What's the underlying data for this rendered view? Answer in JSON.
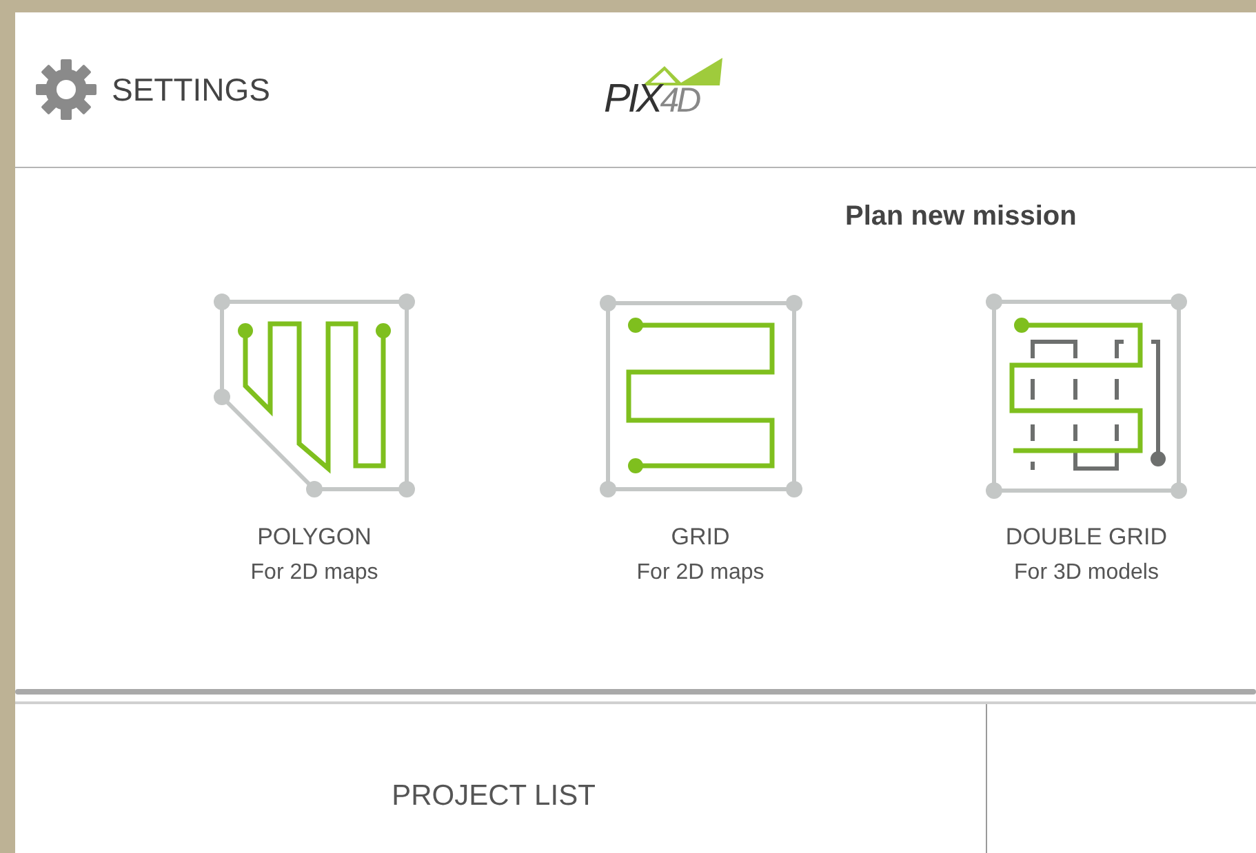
{
  "header": {
    "settings_label": "SETTINGS",
    "logo": {
      "main": "PIX",
      "suffix": "4D"
    }
  },
  "plan": {
    "title": "Plan new mission",
    "missions": [
      {
        "kind": "polygon",
        "title": "POLYGON",
        "subtitle": "For 2D maps"
      },
      {
        "kind": "grid",
        "title": "GRID",
        "subtitle": "For 2D maps"
      },
      {
        "kind": "double_grid",
        "title": "DOUBLE GRID",
        "subtitle": "For 3D models"
      }
    ]
  },
  "footer": {
    "project_list": "PROJECT LIST"
  }
}
